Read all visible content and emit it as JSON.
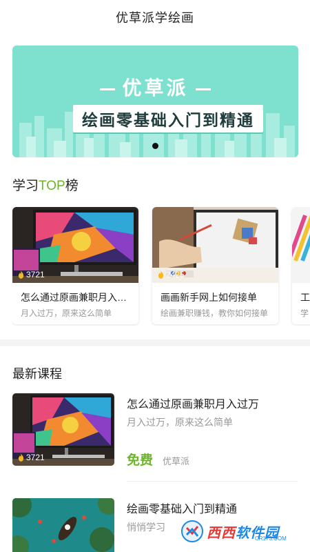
{
  "header": {
    "title": "优草派学绘画"
  },
  "banner": {
    "brand": "优草派",
    "slogan": "绘画零基础入门到精通",
    "page_count": 1,
    "active_page": 1,
    "bg_color": "#7ee0cf"
  },
  "top_section": {
    "title_prefix": "学习",
    "title_accent": "TOP",
    "title_suffix": "榜",
    "accent_color": "#6bb52a",
    "cards": [
      {
        "views": "3721",
        "title": "怎么通过原画兼职月入过万",
        "subtitle": "月入过万，原来这么简单",
        "thumb_icon": "monitor-artwork-image"
      },
      {
        "views": "2425",
        "title": "画画新手网上如何接单",
        "subtitle": "绘画兼职赚钱，教你如何接单",
        "thumb_icon": "painting-desk-image"
      },
      {
        "views": "",
        "title": "工",
        "subtitle": "学",
        "thumb_icon": "colored-pencils-image"
      }
    ]
  },
  "latest_section": {
    "title": "最新课程",
    "courses": [
      {
        "title": "怎么通过原画兼职月入过万",
        "desc": "月入过万，原来这么简单",
        "price": "免费",
        "author": "优草派",
        "views": "3721",
        "thumb_icon": "monitor-artwork-image"
      },
      {
        "title": "绘画零基础入门到精通",
        "desc": "悄悄学习",
        "thumb_icon": "boat-lake-image"
      }
    ]
  },
  "watermark": {
    "text_a": "西西",
    "text_b": "软件园",
    "sub": "CR173.COM"
  },
  "icons": {
    "views": "flame-icon"
  }
}
